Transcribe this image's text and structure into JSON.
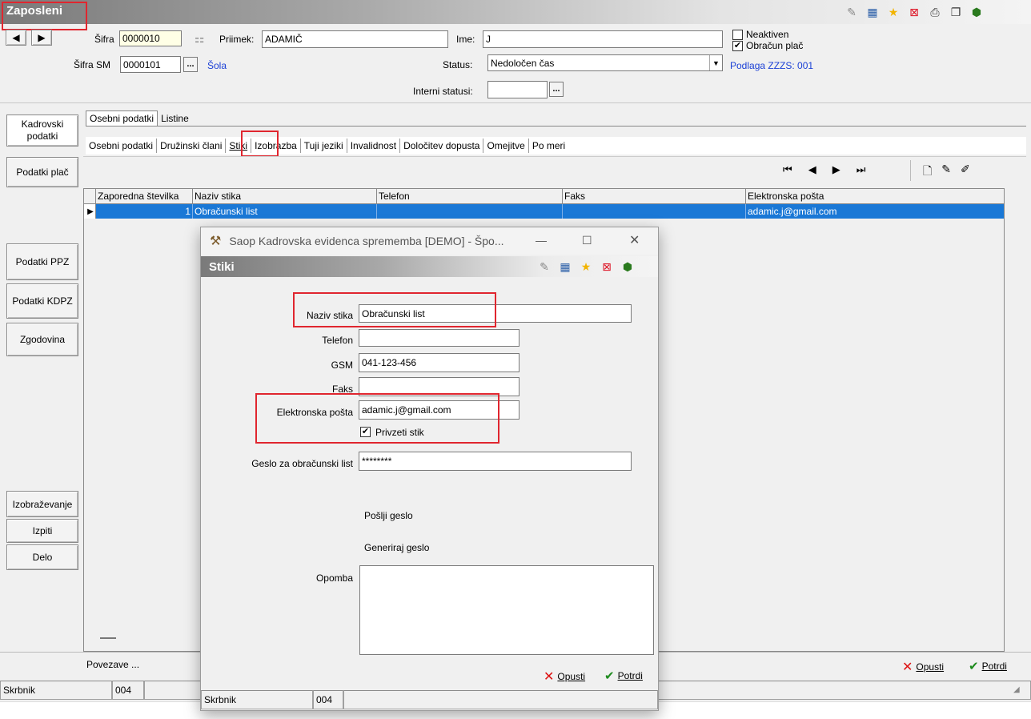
{
  "window": {
    "title": "Zaposleni",
    "toolbar_icons": [
      "edit-icon",
      "grid-icon",
      "star-icon",
      "close-doc-icon",
      "print-icon",
      "copy-icon",
      "tool-icon"
    ]
  },
  "header": {
    "sifra_label": "Šifra",
    "sifra_value": "0000010",
    "priimek_label": "Priimek:",
    "priimek_value": "ADAMIČ",
    "ime_label": "Ime:",
    "ime_value": "J",
    "neaktiven_label": "Neaktiven",
    "obracun_label": "Obračun plač",
    "sifra_sm_label": "Šifra SM",
    "sifra_sm_value": "0000101",
    "sola_link": "Šola",
    "status_label": "Status:",
    "status_value": "Nedoločen čas",
    "podlaga_link": "Podlaga ZZZS: 001",
    "interni_label": "Interni statusi:",
    "ellipsis": "..."
  },
  "sidebar": {
    "kadrovski": "Kadrovski\npodatki",
    "podatki_plac": "Podatki plač",
    "podatki_ppz": "Podatki PPZ",
    "podatki_kdpz": "Podatki KDPZ",
    "zgodovina": "Zgodovina",
    "izobrazevanje": "Izobraževanje",
    "izpiti": "Izpiti",
    "delo": "Delo"
  },
  "tabs_top": [
    "Osebni podatki",
    "Listine"
  ],
  "tabs_sub": [
    "Osebni podatki",
    "Družinski člani",
    "Stiki",
    "Izobrazba",
    "Tuji jeziki",
    "Invalidnost",
    "Določitev dopusta",
    "Omejitve",
    "Po meri"
  ],
  "grid": {
    "columns": [
      "Zaporedna številka",
      "Naziv stika",
      "Telefon",
      "Faks",
      "Elektronska pošta"
    ],
    "rows": [
      {
        "num": "1",
        "naziv": "Obračunski list",
        "telefon": "",
        "faks": "",
        "email": "adamic.j@gmail.com"
      }
    ]
  },
  "bottom": {
    "povezave": "Povezave ...",
    "opusti": "Opusti",
    "potrdi": "Potrdi",
    "status_user": "Skrbnik",
    "status_code": "004"
  },
  "dialog": {
    "title": "Saop Kadrovska evidenca sprememba [DEMO] - Špo...",
    "header": "Stiki",
    "naziv_label": "Naziv stika",
    "naziv_value": "Obračunski list",
    "telefon_label": "Telefon",
    "telefon_value": "",
    "gsm_label": "GSM",
    "gsm_value": "041-123-456",
    "faks_label": "Faks",
    "faks_value": "",
    "email_label": "Elektronska pošta",
    "email_value": "adamic.j@gmail.com",
    "privzeti_label": "Privzeti stik",
    "geslo_label": "Geslo za obračunski list",
    "geslo_value": "********",
    "poslji": "Pošlji geslo",
    "generiraj": "Generiraj geslo",
    "opomba_label": "Opomba",
    "opusti": "Opusti",
    "potrdi": "Potrdi",
    "status_user": "Skrbnik",
    "status_code": "004"
  }
}
